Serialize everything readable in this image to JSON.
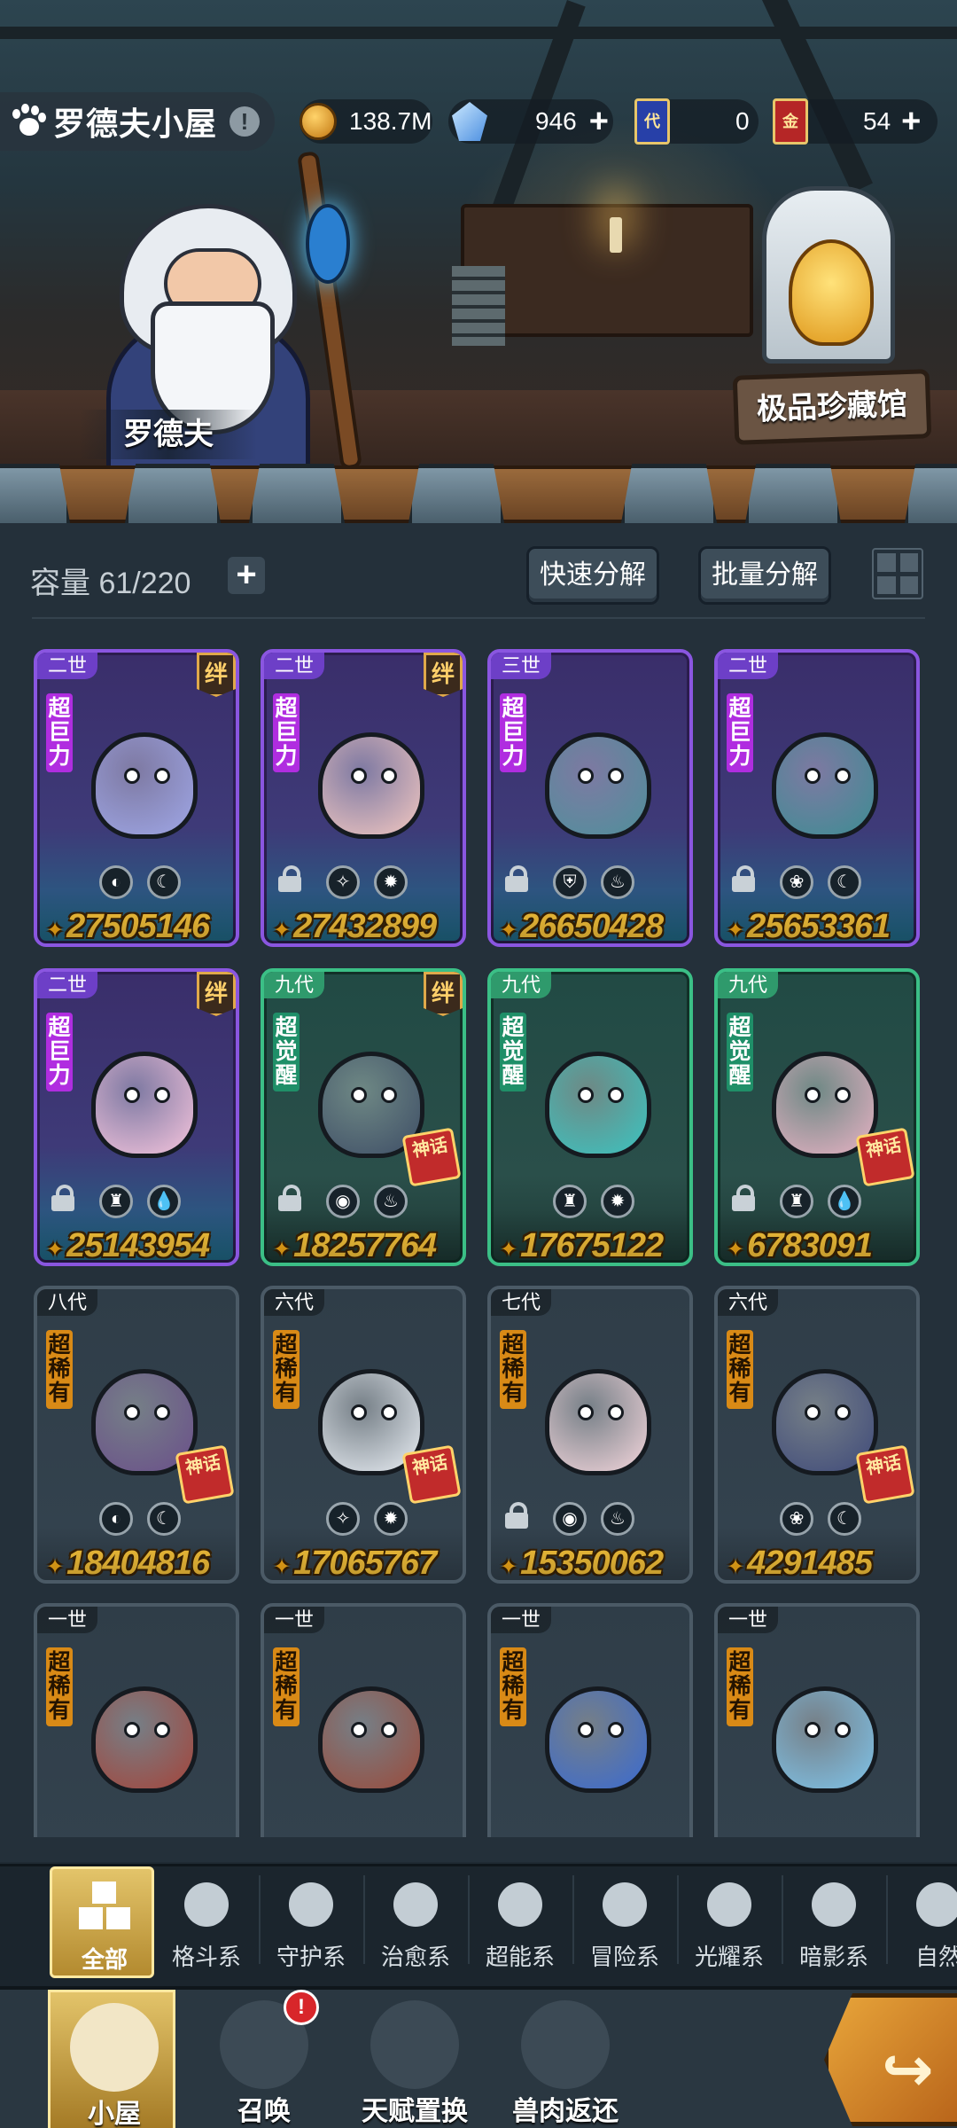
{
  "header": {
    "room_title": "罗德夫小屋",
    "info_icon": "!",
    "resources": [
      {
        "icon": "coin-icon",
        "value": "138.7M",
        "has_plus": false
      },
      {
        "icon": "crystal-icon",
        "value": "946",
        "has_plus": true
      },
      {
        "icon": "ticket-dai-icon",
        "glyph": "代",
        "value": "0",
        "has_plus": false
      },
      {
        "icon": "ticket-jin-icon",
        "glyph": "金",
        "value": "54",
        "has_plus": true
      }
    ],
    "plus_label": "+"
  },
  "scene": {
    "npc_name": "罗德夫",
    "museum_label": "极品珍藏馆"
  },
  "storage": {
    "capacity_label": "容量",
    "capacity_value": "61/220",
    "add_label": "+",
    "quick_decompose": "快速分解",
    "batch_decompose": "批量分解"
  },
  "cards": [
    {
      "gen": "二世",
      "rarity": "超巨力",
      "tier": "purple",
      "bond": "绊",
      "locked": false,
      "attrs": [
        "◐",
        "☾"
      ],
      "power": "27505146",
      "color": "#9fa6e6"
    },
    {
      "gen": "二世",
      "rarity": "超巨力",
      "tier": "purple",
      "bond": "绊",
      "locked": true,
      "attrs": [
        "✧",
        "✹"
      ],
      "power": "27432899",
      "color": "#f3c7c0"
    },
    {
      "gen": "三世",
      "rarity": "超巨力",
      "tier": "purple",
      "bond": "",
      "locked": true,
      "attrs": [
        "⛨",
        "♨"
      ],
      "power": "26650428",
      "color": "#4f8f9a"
    },
    {
      "gen": "二世",
      "rarity": "超巨力",
      "tier": "purple",
      "bond": "",
      "locked": true,
      "attrs": [
        "❀",
        "☾"
      ],
      "power": "25653361",
      "color": "#3d8c92"
    },
    {
      "gen": "二世",
      "rarity": "超巨力",
      "tier": "purple",
      "bond": "绊",
      "locked": true,
      "attrs": [
        "♜",
        "💧"
      ],
      "power": "25143954",
      "color": "#f6c4dc"
    },
    {
      "gen": "九代",
      "rarity": "超觉醒",
      "tier": "green",
      "bond": "绊",
      "locked": true,
      "attrs": [
        "◉",
        "♨"
      ],
      "power": "18257764",
      "color": "#3e4e66",
      "seal": "神话"
    },
    {
      "gen": "九代",
      "rarity": "超觉醒",
      "tier": "green",
      "bond": "",
      "locked": false,
      "attrs": [
        "♜",
        "✹"
      ],
      "power": "17675122",
      "color": "#3bc4c0"
    },
    {
      "gen": "九代",
      "rarity": "超觉醒",
      "tier": "green",
      "bond": "",
      "locked": true,
      "attrs": [
        "♜",
        "💧"
      ],
      "power": "6783091",
      "color": "#e8b2c4",
      "seal": "神话"
    },
    {
      "gen": "八代",
      "rarity": "超稀有",
      "tier": "gray",
      "bond": "",
      "locked": false,
      "attrs": [
        "◐",
        "☾"
      ],
      "power": "18404816",
      "color": "#6a4f8a",
      "seal": "神话"
    },
    {
      "gen": "六代",
      "rarity": "超稀有",
      "tier": "gray",
      "bond": "",
      "locked": false,
      "attrs": [
        "✧",
        "✹"
      ],
      "power": "17065767",
      "color": "#e9eef4",
      "seal": "神话"
    },
    {
      "gen": "七代",
      "rarity": "超稀有",
      "tier": "gray",
      "bond": "",
      "locked": true,
      "attrs": [
        "◉",
        "♨"
      ],
      "power": "15350062",
      "color": "#f4d6dc"
    },
    {
      "gen": "六代",
      "rarity": "超稀有",
      "tier": "gray",
      "bond": "",
      "locked": false,
      "attrs": [
        "❀",
        "☾"
      ],
      "power": "4291485",
      "color": "#3f4a7a",
      "seal": "神话"
    },
    {
      "gen": "一世",
      "rarity": "超稀有",
      "tier": "gray",
      "bond": "",
      "locked": false,
      "attrs": [],
      "power": "",
      "color": "#a4443a"
    },
    {
      "gen": "一世",
      "rarity": "超稀有",
      "tier": "gray",
      "bond": "",
      "locked": false,
      "attrs": [],
      "power": "",
      "color": "#9a4a3a"
    },
    {
      "gen": "一世",
      "rarity": "超稀有",
      "tier": "gray",
      "bond": "",
      "locked": false,
      "attrs": [],
      "power": "",
      "color": "#3a6ad0"
    },
    {
      "gen": "一世",
      "rarity": "超稀有",
      "tier": "gray",
      "bond": "",
      "locked": false,
      "attrs": [],
      "power": "",
      "color": "#7fc4ea"
    }
  ],
  "filters": [
    {
      "label": "全部",
      "icon": "all-blocks-icon",
      "active": true
    },
    {
      "label": "格斗系",
      "icon": "fist-icon",
      "active": false
    },
    {
      "label": "守护系",
      "icon": "shield-icon",
      "active": false
    },
    {
      "label": "治愈系",
      "icon": "sprout-icon",
      "active": false
    },
    {
      "label": "超能系",
      "icon": "alien-icon",
      "active": false
    },
    {
      "label": "冒险系",
      "icon": "lantern-icon",
      "active": false
    },
    {
      "label": "光耀系",
      "icon": "star-cross-icon",
      "active": false
    },
    {
      "label": "暗影系",
      "icon": "dark-eye-icon",
      "active": false
    },
    {
      "label": "自然",
      "icon": "leaf-icon",
      "active": false
    }
  ],
  "nav": [
    {
      "label": "小屋",
      "icon": "house-icon",
      "active": true
    },
    {
      "label": "召唤",
      "icon": "egg-icon",
      "active": false,
      "alert": "!"
    },
    {
      "label": "天赋置换",
      "icon": "swap-arrows-icon",
      "active": false
    },
    {
      "label": "兽肉返还",
      "icon": "meat-icon",
      "active": false
    }
  ]
}
